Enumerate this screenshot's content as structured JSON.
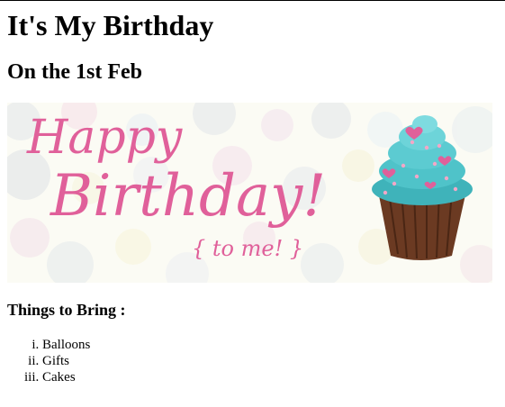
{
  "page": {
    "title": "It's My Birthday",
    "subtitle": "On the 1st Feb",
    "banner": {
      "line1": "Happy",
      "line2": "Birthday!",
      "line3": "{ to me! }",
      "accent": "#e0609a",
      "frosting": "#4fc3c9",
      "cake": "#6b3a22"
    },
    "list_heading": "Things to Bring :",
    "items": [
      "Balloons",
      "Gifts",
      "Cakes"
    ]
  }
}
